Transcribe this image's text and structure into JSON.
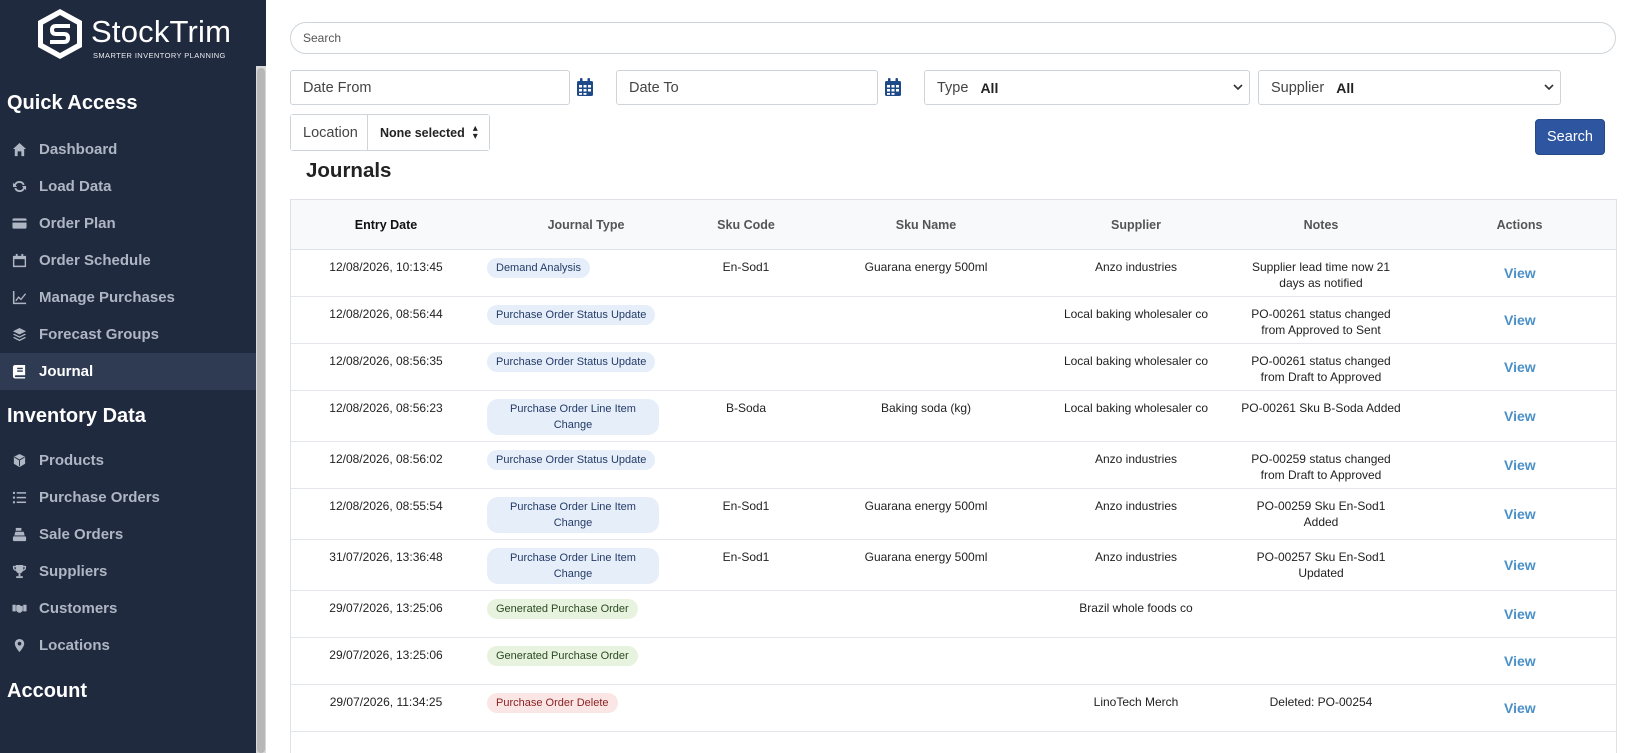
{
  "brand": {
    "name": "StockTrim",
    "tagline": "SMARTER INVENTORY PLANNING"
  },
  "sidebar": {
    "sections": [
      {
        "title": "Quick Access",
        "items": [
          {
            "label": "Dashboard",
            "icon": "home-icon",
            "active": false
          },
          {
            "label": "Load Data",
            "icon": "refresh-icon",
            "active": false
          },
          {
            "label": "Order Plan",
            "icon": "credit-card-icon",
            "active": false
          },
          {
            "label": "Order Schedule",
            "icon": "calendar-icon",
            "active": false
          },
          {
            "label": "Manage Purchases",
            "icon": "line-chart-icon",
            "active": false
          },
          {
            "label": "Forecast Groups",
            "icon": "layers-icon",
            "active": false
          },
          {
            "label": "Journal",
            "icon": "book-icon",
            "active": true
          }
        ]
      },
      {
        "title": "Inventory Data",
        "items": [
          {
            "label": "Products",
            "icon": "cubes-icon",
            "active": false
          },
          {
            "label": "Purchase Orders",
            "icon": "list-icon",
            "active": false
          },
          {
            "label": "Sale Orders",
            "icon": "cash-register-icon",
            "active": false
          },
          {
            "label": "Suppliers",
            "icon": "trophy-icon",
            "active": false
          },
          {
            "label": "Customers",
            "icon": "handshake-icon",
            "active": false
          },
          {
            "label": "Locations",
            "icon": "map-marker-icon",
            "active": false
          }
        ]
      },
      {
        "title": "Account",
        "items": []
      }
    ]
  },
  "filters": {
    "search_placeholder": "Search",
    "date_from_placeholder": "Date From",
    "date_to_placeholder": "Date To",
    "type_label": "Type",
    "type_value": "All",
    "supplier_label": "Supplier",
    "supplier_value": "All",
    "location_label": "Location",
    "location_value": "None selected",
    "search_button": "Search"
  },
  "journals": {
    "title": "Journals",
    "columns": [
      "Entry Date",
      "Journal Type",
      "Sku Code",
      "Sku Name",
      "Supplier",
      "Notes",
      "Actions"
    ],
    "rows": [
      {
        "date": "12/08/2026, 10:13:45",
        "type": "Demand Analysis",
        "type_color": "blue",
        "sku_code": "En-Sod1",
        "sku_name": "Guarana energy 500ml",
        "supplier": "Anzo industries",
        "notes": "Supplier lead time now 21 days as notified",
        "action": "View"
      },
      {
        "date": "12/08/2026, 08:56:44",
        "type": "Purchase Order Status Update",
        "type_color": "blue",
        "sku_code": "",
        "sku_name": "",
        "supplier": "Local baking wholesaler co",
        "notes": "PO-00261 status changed from Approved to Sent",
        "action": "View"
      },
      {
        "date": "12/08/2026, 08:56:35",
        "type": "Purchase Order Status Update",
        "type_color": "blue",
        "sku_code": "",
        "sku_name": "",
        "supplier": "Local baking wholesaler co",
        "notes": "PO-00261 status changed from Draft to Approved",
        "action": "View"
      },
      {
        "date": "12/08/2026, 08:56:23",
        "type": "Purchase Order Line Item Change",
        "type_color": "blue",
        "sku_code": "B-Soda",
        "sku_name": "Baking soda (kg)",
        "supplier": "Local baking wholesaler co",
        "notes": "PO-00261 Sku B-Soda Added",
        "action": "View"
      },
      {
        "date": "12/08/2026, 08:56:02",
        "type": "Purchase Order Status Update",
        "type_color": "blue",
        "sku_code": "",
        "sku_name": "",
        "supplier": "Anzo industries",
        "notes": "PO-00259 status changed from Draft to Approved",
        "action": "View"
      },
      {
        "date": "12/08/2026, 08:55:54",
        "type": "Purchase Order Line Item Change",
        "type_color": "blue",
        "sku_code": "En-Sod1",
        "sku_name": "Guarana energy 500ml",
        "supplier": "Anzo industries",
        "notes": "PO-00259 Sku En-Sod1 Added",
        "action": "View"
      },
      {
        "date": "31/07/2026, 13:36:48",
        "type": "Purchase Order Line Item Change",
        "type_color": "blue",
        "sku_code": "En-Sod1",
        "sku_name": "Guarana energy 500ml",
        "supplier": "Anzo industries",
        "notes": "PO-00257 Sku En-Sod1 Updated",
        "action": "View"
      },
      {
        "date": "29/07/2026, 13:25:06",
        "type": "Generated Purchase Order",
        "type_color": "green",
        "sku_code": "",
        "sku_name": "",
        "supplier": "Brazil whole foods co",
        "notes": "",
        "action": "View"
      },
      {
        "date": "29/07/2026, 13:25:06",
        "type": "Generated Purchase Order",
        "type_color": "green",
        "sku_code": "",
        "sku_name": "",
        "supplier": "",
        "notes": "",
        "action": "View"
      },
      {
        "date": "29/07/2026, 11:34:25",
        "type": "Purchase Order Delete",
        "type_color": "red",
        "sku_code": "",
        "sku_name": "",
        "supplier": "LinoTech Merch",
        "notes": "Deleted: PO-00254",
        "action": "View"
      }
    ]
  },
  "colors": {
    "sidebar_bg": "#202a3e",
    "accent": "#2e55a0",
    "link": "#4a90c8"
  }
}
